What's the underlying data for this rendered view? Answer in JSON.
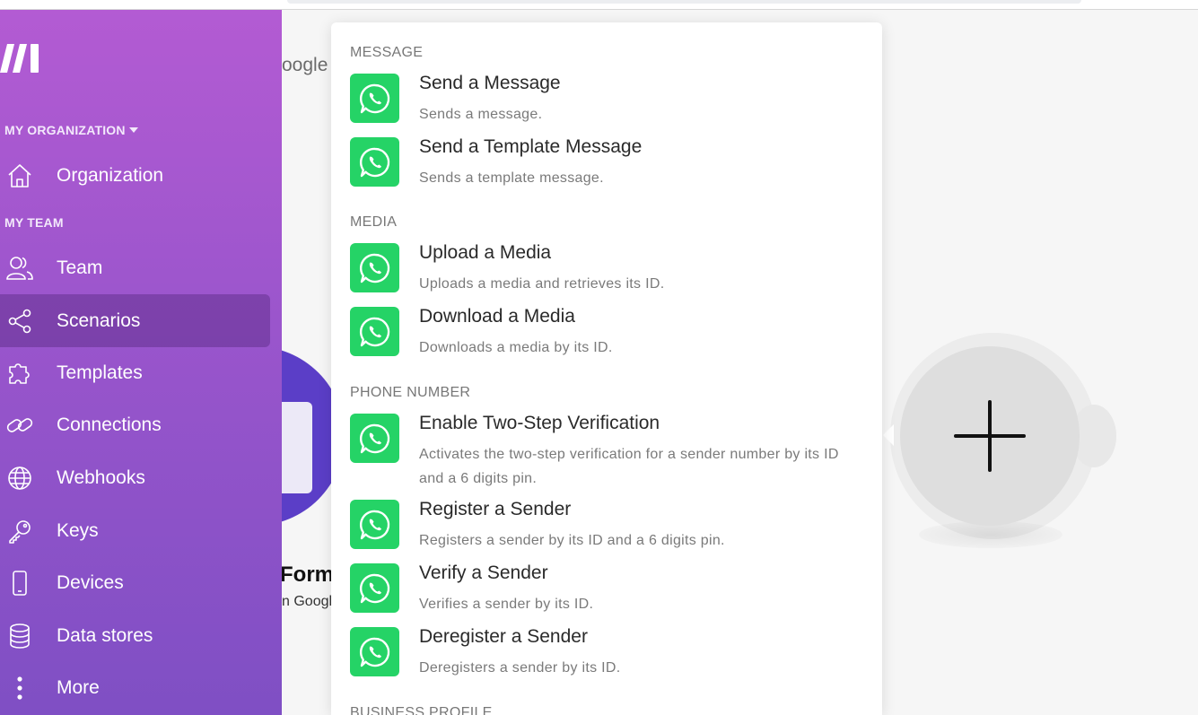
{
  "sidebar": {
    "org_section": "MY ORGANIZATION",
    "team_section": "MY TEAM",
    "items": [
      {
        "label": "Organization",
        "icon": "home-icon"
      },
      {
        "label": "Team",
        "icon": "users-icon"
      },
      {
        "label": "Scenarios",
        "icon": "share-icon",
        "active": true
      },
      {
        "label": "Templates",
        "icon": "puzzle-icon"
      },
      {
        "label": "Connections",
        "icon": "link-icon"
      },
      {
        "label": "Webhooks",
        "icon": "globe-icon"
      },
      {
        "label": "Keys",
        "icon": "key-icon"
      },
      {
        "label": "Devices",
        "icon": "phone-icon"
      },
      {
        "label": "Data stores",
        "icon": "database-icon"
      },
      {
        "label": "More",
        "icon": "more-vertical-icon"
      }
    ]
  },
  "canvas": {
    "peek_text": "oogle",
    "module_title": "Form",
    "module_subtitle": "n Googl"
  },
  "panel": {
    "groups": [
      {
        "title": "MESSAGE",
        "actions": [
          {
            "name": "Send a Message",
            "desc": "Sends a message."
          },
          {
            "name": "Send a Template Message",
            "desc": "Sends a template message."
          }
        ]
      },
      {
        "title": "MEDIA",
        "actions": [
          {
            "name": "Upload a Media",
            "desc": "Uploads a media and retrieves its ID."
          },
          {
            "name": "Download a Media",
            "desc": "Downloads a media by its ID."
          }
        ]
      },
      {
        "title": "PHONE NUMBER",
        "actions": [
          {
            "name": "Enable Two-Step Verification",
            "desc": "Activates the two-step verification for a sender number by its ID and a 6 digits pin."
          },
          {
            "name": "Register a Sender",
            "desc": "Registers a sender by its ID and a 6 digits pin."
          },
          {
            "name": "Verify a Sender",
            "desc": "Verifies a sender by its ID."
          },
          {
            "name": "Deregister a Sender",
            "desc": "Deregisters a sender by its ID."
          }
        ]
      },
      {
        "title": "BUSINESS PROFILE",
        "actions": []
      }
    ]
  },
  "colors": {
    "sidebar_top": "#b35bd3",
    "sidebar_bottom": "#7f4fc4",
    "whatsapp": "#25d366",
    "forms_purple": "#5b3ec7"
  }
}
